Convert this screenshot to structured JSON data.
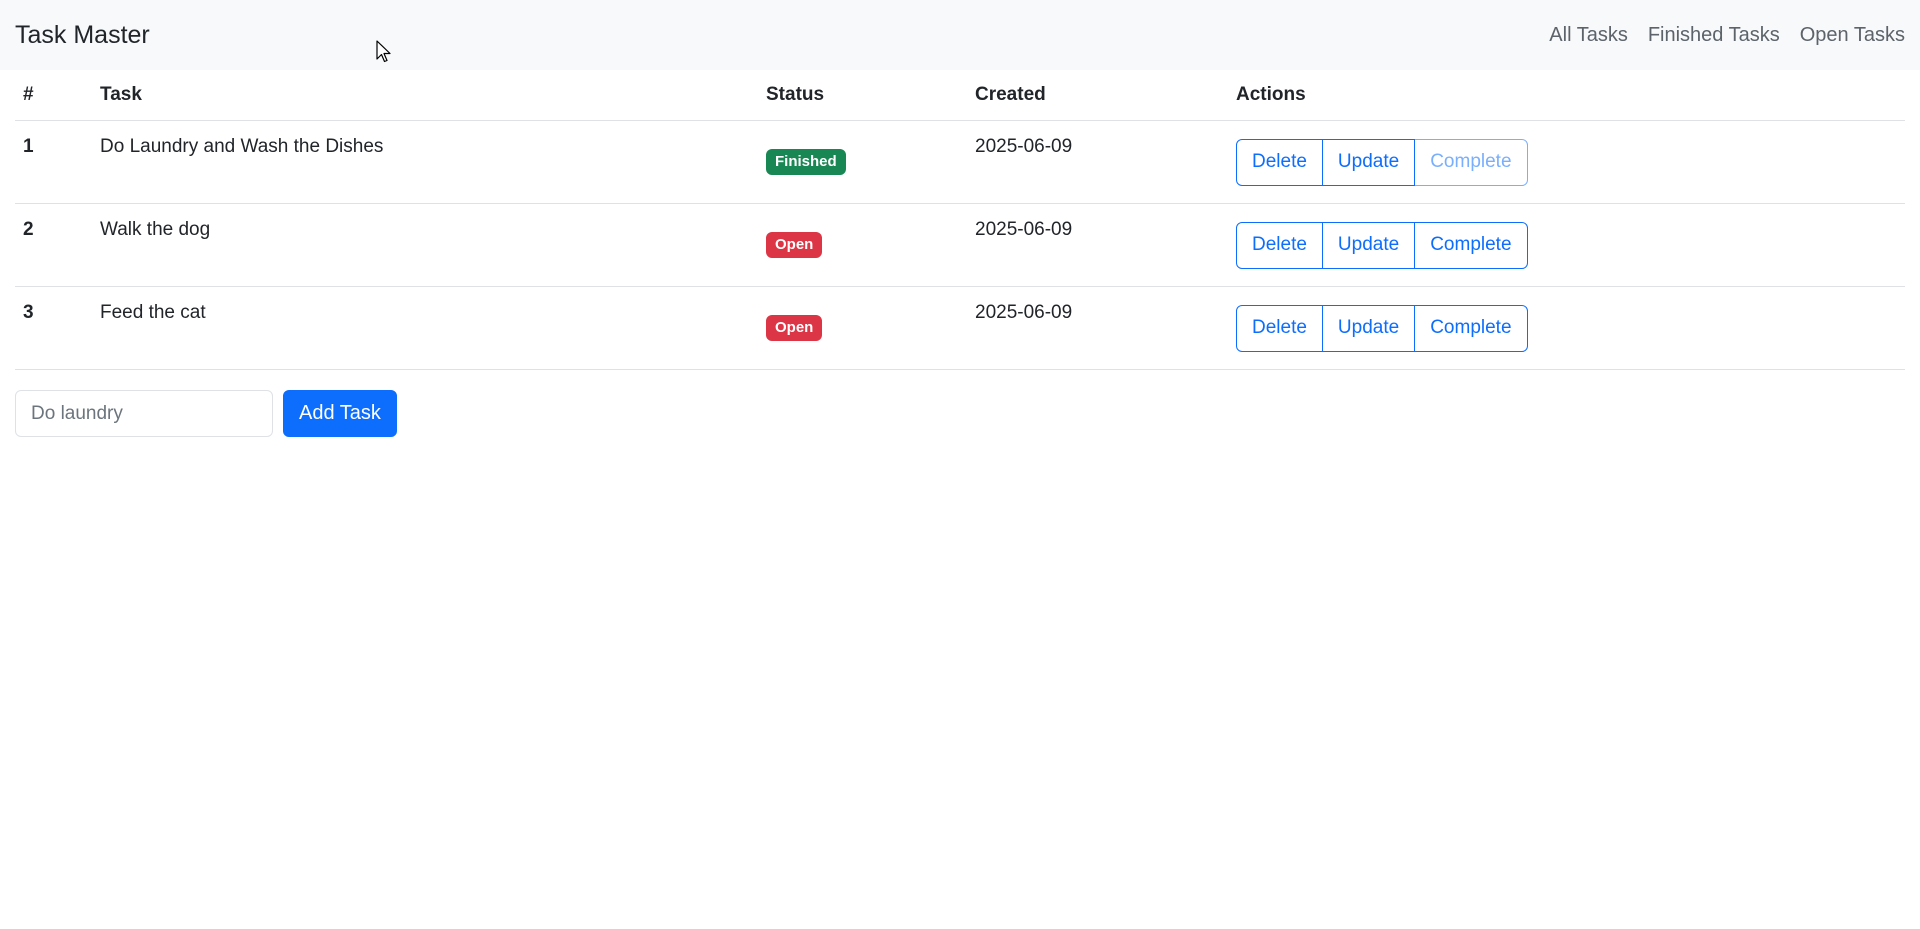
{
  "navbar": {
    "brand": "Task Master",
    "links": [
      "All Tasks",
      "Finished Tasks",
      "Open Tasks"
    ]
  },
  "table": {
    "headers": [
      "#",
      "Task",
      "Status",
      "Created",
      "Actions"
    ],
    "rows": [
      {
        "num": "1",
        "task": "Do Laundry and Wash the Dishes",
        "status": "Finished",
        "created": "2025-06-09",
        "actions": [
          "Delete",
          "Update",
          "Complete"
        ],
        "complete_disabled": true
      },
      {
        "num": "2",
        "task": "Walk the dog",
        "status": "Open",
        "created": "2025-06-09",
        "actions": [
          "Delete",
          "Update",
          "Complete"
        ],
        "complete_disabled": false
      },
      {
        "num": "3",
        "task": "Feed the cat",
        "status": "Open",
        "created": "2025-06-09",
        "actions": [
          "Delete",
          "Update",
          "Complete"
        ],
        "complete_disabled": false
      }
    ]
  },
  "add_form": {
    "input_value": "",
    "input_placeholder": "Do laundry",
    "button_label": "Add Task"
  },
  "colors": {
    "primary": "#0d6efd",
    "finished_badge": "#198754",
    "open_badge": "#dc3545",
    "navbar_bg": "#f8f9fa"
  },
  "icons": {
    "cursor": "mouse-pointer-icon"
  }
}
